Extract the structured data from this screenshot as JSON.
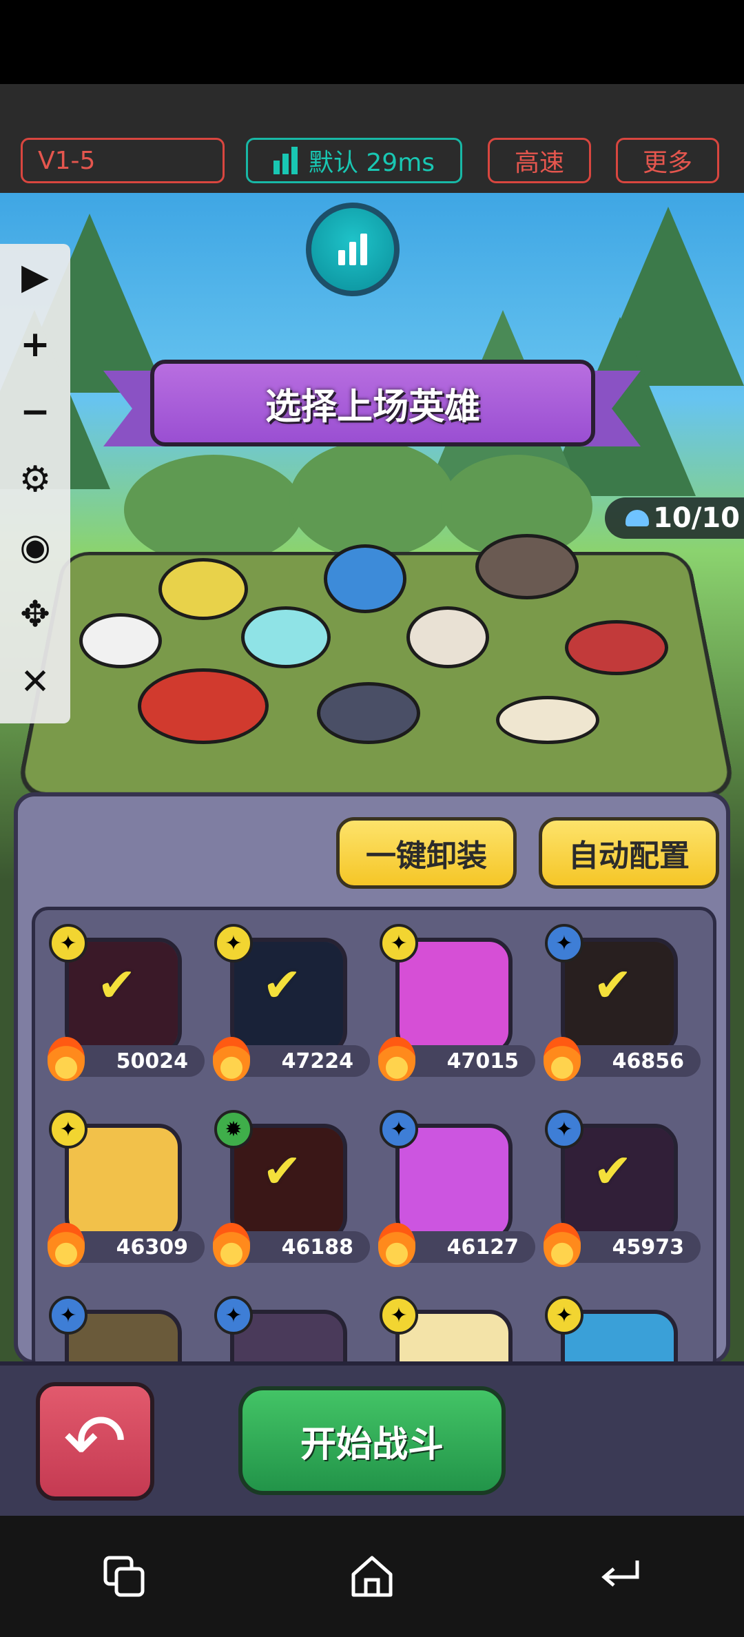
{
  "toolbar": {
    "level": "V1-5",
    "ping_label": "默认 29ms",
    "speed_label": "高速",
    "more_label": "更多"
  },
  "scene": {
    "banner_title": "选择上场英雄",
    "hero_count": "10/10"
  },
  "side_tools": [
    "play-icon",
    "zoom-in-icon",
    "zoom-out-icon",
    "gear-icon",
    "eye-icon",
    "move-icon",
    "close-icon"
  ],
  "roster": {
    "unequip_label": "一键卸装",
    "autoconfig_label": "自动配置",
    "heroes": [
      {
        "power": "50024",
        "selected": true,
        "rank": "gold",
        "color": "#6a2e4a"
      },
      {
        "power": "47224",
        "selected": true,
        "rank": "gold",
        "color": "#2e3f66"
      },
      {
        "power": "47015",
        "selected": false,
        "rank": "gold",
        "color": "#d64fd6"
      },
      {
        "power": "46856",
        "selected": true,
        "rank": "blue",
        "color": "#4a3a3a"
      },
      {
        "power": "46309",
        "selected": false,
        "rank": "gold",
        "color": "#f2c14a"
      },
      {
        "power": "46188",
        "selected": true,
        "rank": "green",
        "color": "#6b2b2b"
      },
      {
        "power": "46127",
        "selected": false,
        "rank": "blue",
        "color": "#cc55e0"
      },
      {
        "power": "45973",
        "selected": true,
        "rank": "blue",
        "color": "#5a3a66"
      }
    ]
  },
  "actions": {
    "start_label": "开始战斗"
  },
  "colors": {
    "accent_red": "#e5564e",
    "accent_teal": "#19c7b3",
    "start_green": "#2fae57",
    "back_red": "#d34a5f"
  }
}
